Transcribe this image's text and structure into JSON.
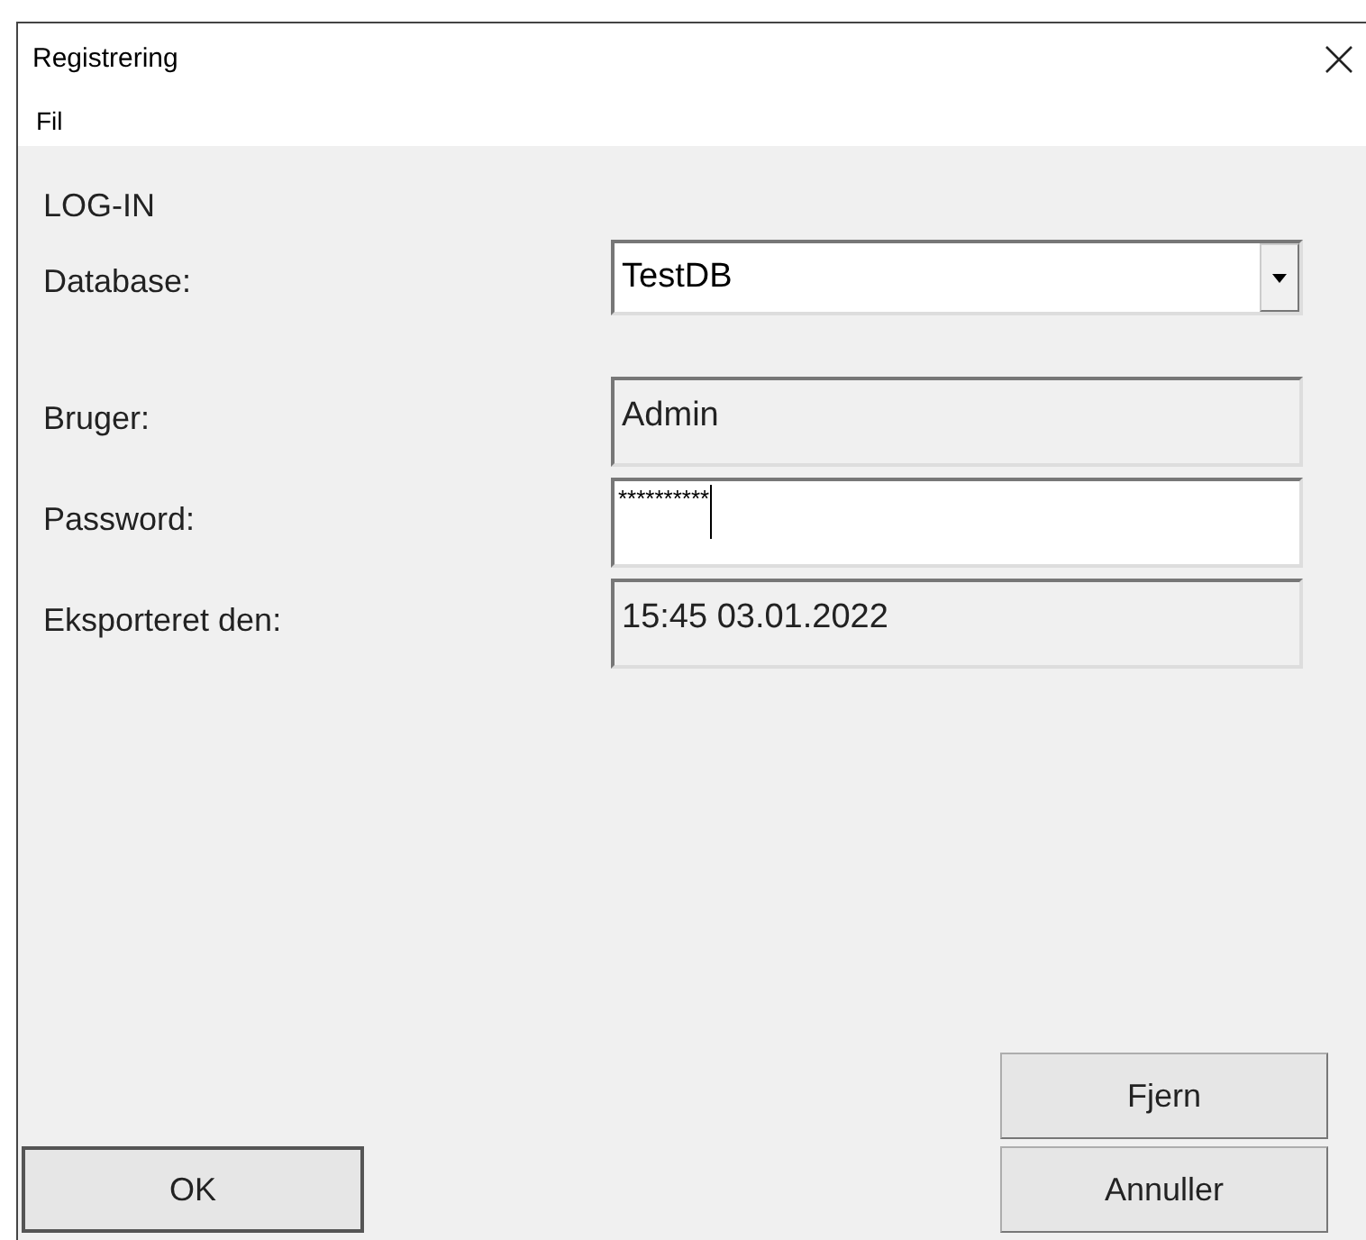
{
  "window": {
    "title": "Registrering"
  },
  "menu": [
    "Fil"
  ],
  "heading": "LOG-IN",
  "fields": [
    {
      "label": "Database:",
      "kind": "dropdown",
      "value": "TestDB",
      "disabled": false
    },
    {
      "label": "Bruger:",
      "kind": "text",
      "value": "Admin",
      "disabled": true
    },
    {
      "label": "Password:",
      "kind": "password",
      "value": "**********",
      "disabled": false
    },
    {
      "label": "Eksporteret den:",
      "kind": "text",
      "value": "15:45 03.01.2022",
      "disabled": true
    }
  ],
  "buttons": {
    "ok": "OK",
    "remove": "Fjern",
    "cancel": "Annuller"
  }
}
